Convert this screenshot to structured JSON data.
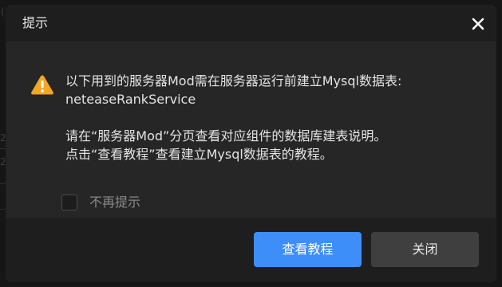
{
  "dialog": {
    "title": "提示",
    "close_icon": "close-icon",
    "warning_icon": "warning-triangle-icon",
    "warning_color": "#f5a623",
    "message_line1": "以下用到的服务器Mod需在服务器运行前建立Mysql数据表:",
    "message_line2": "neteaseRankService",
    "message_line3": "请在“服务器Mod”分页查看对应组件的数据库建表说明。",
    "message_line4": "点击“查看教程”查看建立Mysql数据表的教程。",
    "checkbox_label": "不再提示",
    "checkbox_checked": false,
    "primary_button": "查看教程",
    "secondary_button": "关闭",
    "accent_color": "#3d8ef8"
  }
}
